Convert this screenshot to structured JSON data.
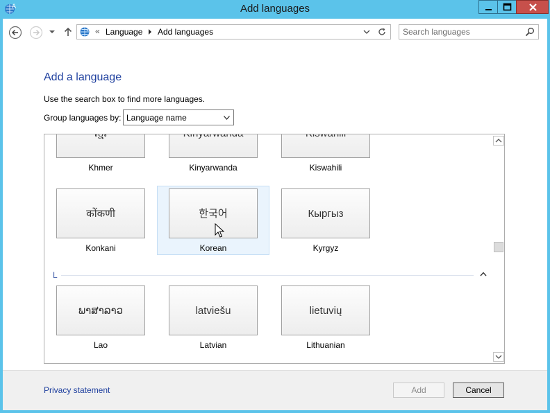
{
  "window": {
    "title": "Add languages"
  },
  "nav": {
    "breadcrumb": [
      "Language",
      "Add languages"
    ],
    "overflow_glyph": "«"
  },
  "search": {
    "placeholder": "Search languages"
  },
  "page": {
    "heading": "Add a language",
    "instruction": "Use the search box to find more languages.",
    "group_by_label": "Group languages by:",
    "group_by_value": "Language name"
  },
  "groups": [
    {
      "letter": "",
      "rows": [
        [
          {
            "native": "ខ្មែរ",
            "name": "Khmer"
          },
          {
            "native": "Kinyarwanda",
            "name": "Kinyarwanda"
          },
          {
            "native": "Kiswahili",
            "name": "Kiswahili"
          }
        ],
        [
          {
            "native": "कोंकणी",
            "name": "Konkani"
          },
          {
            "native": "한국어",
            "name": "Korean",
            "selected": true
          },
          {
            "native": "Кыргыз",
            "name": "Kyrgyz"
          }
        ]
      ]
    },
    {
      "letter": "L",
      "rows": [
        [
          {
            "native": "ພາສາລາວ",
            "name": "Lao"
          },
          {
            "native": "latviešu",
            "name": "Latvian"
          },
          {
            "native": "lietuvių",
            "name": "Lithuanian"
          }
        ]
      ]
    }
  ],
  "footer": {
    "privacy_link": "Privacy statement",
    "add_button": "Add",
    "cancel_button": "Cancel"
  },
  "colors": {
    "title_bar": "#5bc3ea",
    "link": "#1e3f9e",
    "selection": "#eaf4fd",
    "close_button": "#c7504b"
  }
}
